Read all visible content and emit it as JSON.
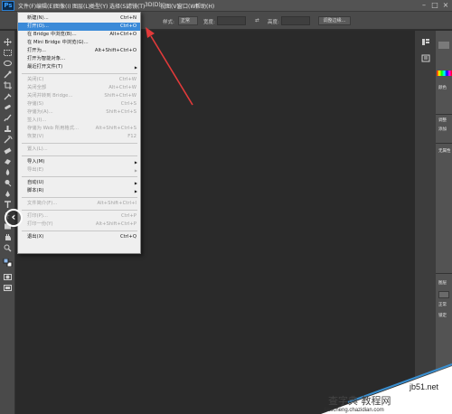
{
  "app": {
    "logo": "Ps"
  },
  "menubar": {
    "items": [
      "文件(F)",
      "编辑(E)",
      "图像(I)",
      "图层(L)",
      "类型(Y)",
      "选择(S)",
      "滤镜(T)",
      "3D(D)",
      "视图(V)",
      "窗口(W)",
      "帮助(H)"
    ],
    "window_controls": [
      "–",
      "□",
      "×"
    ]
  },
  "options_bar": {
    "style_label": "样式:",
    "style_value": "正常",
    "width_label": "宽度:",
    "height_label": "高度:",
    "refine_edge_button": "调整边缘..."
  },
  "file_menu": {
    "sections": [
      [
        {
          "label": "新建(N)...",
          "shortcut": "Ctrl+N",
          "enabled": true
        },
        {
          "label": "打开(O)...",
          "shortcut": "Ctrl+O",
          "enabled": true,
          "highlighted": true
        },
        {
          "label": "在 Bridge 中浏览(B)...",
          "shortcut": "Alt+Ctrl+O",
          "enabled": true
        },
        {
          "label": "在 Mini Bridge 中浏览(G)...",
          "shortcut": "",
          "enabled": true
        },
        {
          "label": "打开为...",
          "shortcut": "Alt+Shift+Ctrl+O",
          "enabled": true
        },
        {
          "label": "打开为智能对象...",
          "shortcut": "",
          "enabled": true
        },
        {
          "label": "最近打开文件(T)",
          "shortcut": "",
          "enabled": true,
          "submenu": true
        }
      ],
      [
        {
          "label": "关闭(C)",
          "shortcut": "Ctrl+W",
          "enabled": false
        },
        {
          "label": "关闭全部",
          "shortcut": "Alt+Ctrl+W",
          "enabled": false
        },
        {
          "label": "关闭并转到 Bridge...",
          "shortcut": "Shift+Ctrl+W",
          "enabled": false
        },
        {
          "label": "存储(S)",
          "shortcut": "Ctrl+S",
          "enabled": false
        },
        {
          "label": "存储为(A)...",
          "shortcut": "Shift+Ctrl+S",
          "enabled": false
        },
        {
          "label": "签入(I)...",
          "shortcut": "",
          "enabled": false
        },
        {
          "label": "存储为 Web 所用格式...",
          "shortcut": "Alt+Shift+Ctrl+S",
          "enabled": false
        },
        {
          "label": "恢复(V)",
          "shortcut": "F12",
          "enabled": false
        }
      ],
      [
        {
          "label": "置入(L)...",
          "shortcut": "",
          "enabled": false
        }
      ],
      [
        {
          "label": "导入(M)",
          "shortcut": "",
          "enabled": true,
          "submenu": true
        },
        {
          "label": "导出(E)",
          "shortcut": "",
          "enabled": false,
          "submenu": true
        }
      ],
      [
        {
          "label": "自动(U)",
          "shortcut": "",
          "enabled": true,
          "submenu": true
        },
        {
          "label": "脚本(R)",
          "shortcut": "",
          "enabled": true,
          "submenu": true
        }
      ],
      [
        {
          "label": "文件简介(F)...",
          "shortcut": "Alt+Shift+Ctrl+I",
          "enabled": false
        }
      ],
      [
        {
          "label": "打印(P)...",
          "shortcut": "Ctrl+P",
          "enabled": false
        },
        {
          "label": "打印一份(Y)",
          "shortcut": "Alt+Shift+Ctrl+P",
          "enabled": false
        }
      ],
      [
        {
          "label": "退出(X)",
          "shortcut": "Ctrl+Q",
          "enabled": true
        }
      ]
    ]
  },
  "right_panel": {
    "labels": [
      "颜色",
      "调整",
      "添加",
      "无属性",
      "图层",
      "正常",
      "锁定"
    ]
  },
  "watermark": {
    "line1": "jb51.net",
    "line2": "查字典 教程网",
    "line3": "jiaocheng.chazidian.com"
  },
  "colors": {
    "highlight": "#3b8ad8",
    "annotation_arrow": "#e23a3a",
    "menu_bg": "#efefef"
  }
}
